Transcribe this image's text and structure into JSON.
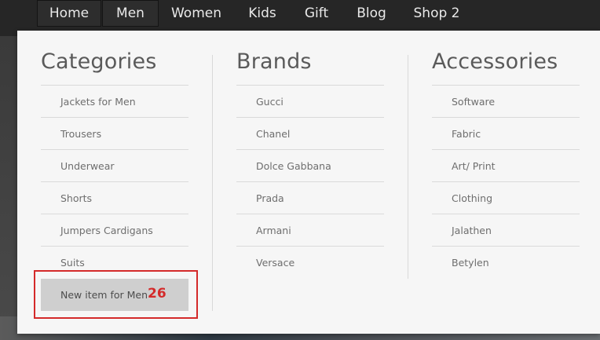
{
  "nav": {
    "items": [
      "Home",
      "Men",
      "Women",
      "Kids",
      "Gift",
      "Blog",
      "Shop 2"
    ]
  },
  "mega_menu": {
    "columns": [
      {
        "title": "Categories",
        "items": [
          "Jackets for Men",
          "Trousers",
          "Underwear",
          "Shorts",
          "Jumpers Cardigans",
          "Suits",
          "New item for Men"
        ]
      },
      {
        "title": "Brands",
        "items": [
          "Gucci",
          "Chanel",
          "Dolce Gabbana",
          "Prada",
          "Armani",
          "Versace"
        ]
      },
      {
        "title": "Accessories",
        "items": [
          "Software",
          "Fabric",
          "Art/ Print",
          "Clothing",
          "Jalathen",
          "Betylen"
        ]
      }
    ],
    "badge": "26"
  },
  "colors": {
    "nav_bg": "#262626",
    "panel_bg": "#f6f6f6",
    "highlight": "#cfcfcf",
    "annotation_red": "#d42a2a"
  }
}
